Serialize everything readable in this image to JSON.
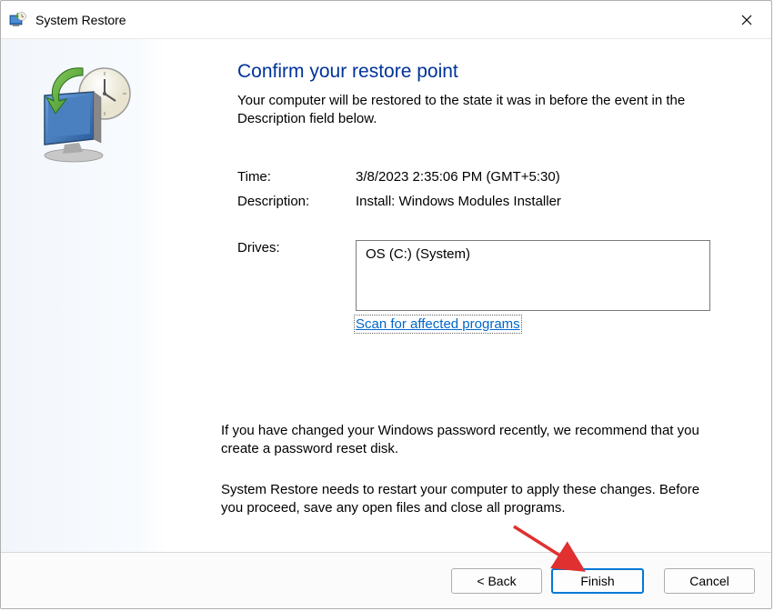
{
  "titlebar": {
    "title": "System Restore"
  },
  "main": {
    "heading": "Confirm your restore point",
    "subheading": "Your computer will be restored to the state it was in before the event in the Description field below.",
    "time_label": "Time:",
    "time_value": "3/8/2023 2:35:06 PM (GMT+5:30)",
    "description_label": "Description:",
    "description_value": "Install: Windows Modules Installer",
    "drives_label": "Drives:",
    "drives_value": "OS (C:) (System)",
    "scan_link": "Scan for affected programs",
    "password_note": "If you have changed your Windows password recently, we recommend that you create a password reset disk.",
    "restart_note": "System Restore needs to restart your computer to apply these changes. Before you proceed, save any open files and close all programs."
  },
  "footer": {
    "back": "< Back",
    "finish": "Finish",
    "cancel": "Cancel"
  }
}
